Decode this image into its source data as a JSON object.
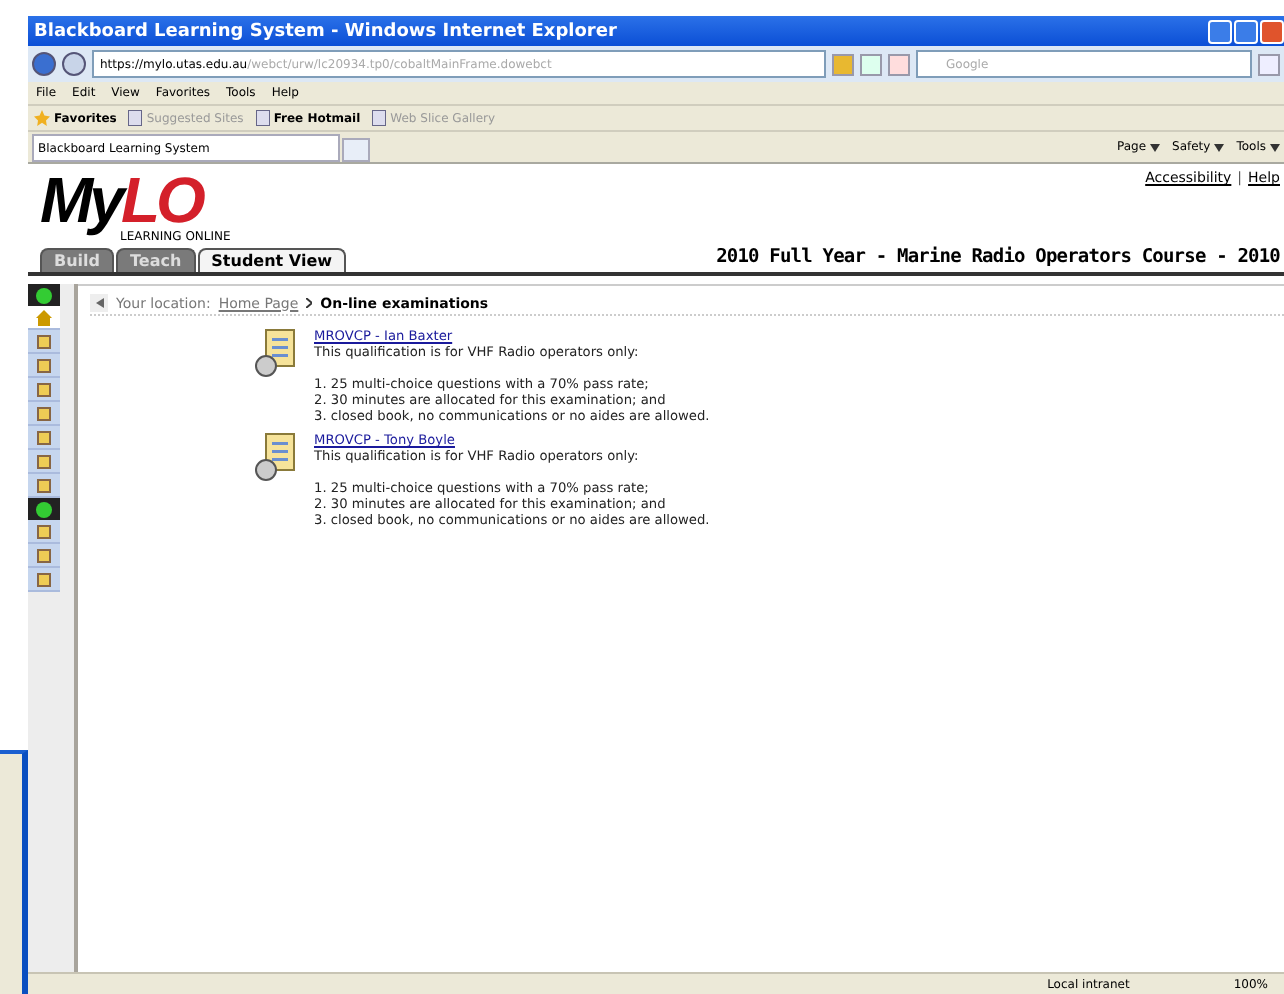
{
  "window": {
    "title": "Blackboard Learning System - Windows Internet Explorer"
  },
  "address_bar": {
    "scheme": "https://",
    "host": "mylo.utas.edu.au",
    "path": "/webct/urw/lc20934.tp0/cobaltMainFrame.dowebct"
  },
  "search_field": {
    "placeholder": "Google"
  },
  "menu": [
    "File",
    "Edit",
    "View",
    "Favorites",
    "Tools",
    "Help"
  ],
  "favorites_bar": [
    {
      "label": "Favorites",
      "kind": "star"
    },
    {
      "label": "Suggested Sites",
      "kind": "ie",
      "dim": true
    },
    {
      "label": "Free Hotmail",
      "kind": "ie",
      "dim": false
    },
    {
      "label": "Web Slice Gallery",
      "kind": "ie",
      "dim": true
    }
  ],
  "browser_tab": {
    "title": "Blackboard Learning System"
  },
  "command_bar": [
    "Page",
    "Safety",
    "Tools"
  ],
  "site": {
    "logo_main": "My",
    "logo_accent": "LO",
    "logo_sub": "LEARNING ONLINE",
    "links": [
      "Accessibility",
      "Help"
    ],
    "link_separator": "|",
    "tabs": [
      {
        "label": "Build",
        "selected": false
      },
      {
        "label": "Teach",
        "selected": false
      },
      {
        "label": "Student View",
        "selected": true
      }
    ],
    "course_title": "2010 Full Year - Marine Radio Operators Course - 2010"
  },
  "sidebar": [
    {
      "expanded": true,
      "tools": [
        {
          "kind": "home",
          "selected": true
        },
        {
          "kind": "tool",
          "selected": false
        },
        {
          "kind": "tool",
          "selected": false
        },
        {
          "kind": "tool",
          "selected": false
        },
        {
          "kind": "tool",
          "selected": false
        },
        {
          "kind": "tool",
          "selected": false
        },
        {
          "kind": "tool",
          "selected": false
        },
        {
          "kind": "tool",
          "selected": false
        }
      ]
    },
    {
      "expanded": true,
      "tools": [
        {
          "kind": "tool",
          "selected": false
        },
        {
          "kind": "tool",
          "selected": false
        },
        {
          "kind": "tool",
          "selected": false
        }
      ]
    }
  ],
  "breadcrumb": {
    "label": "Your location:",
    "link": "Home Page",
    "current": "On-line examinations"
  },
  "exams": [
    {
      "title": "MROVCP - Ian Baxter",
      "intro": "This qualification is for VHF Radio operators only:",
      "points": [
        "1. 25 multi-choice questions with a 70% pass rate;",
        "2. 30 minutes are allocated for this examination; and",
        "3. closed book, no communications or no aides are allowed."
      ]
    },
    {
      "title": "MROVCP - Tony Boyle",
      "intro": "This qualification is for VHF Radio operators only:",
      "points": [
        "1. 25 multi-choice questions with a 70% pass rate;",
        "2. 30 minutes are allocated for this examination; and",
        "3. closed book, no communications or no aides are allowed."
      ]
    }
  ],
  "status_bar": {
    "zone": "Local intranet",
    "zoom": "100%"
  }
}
